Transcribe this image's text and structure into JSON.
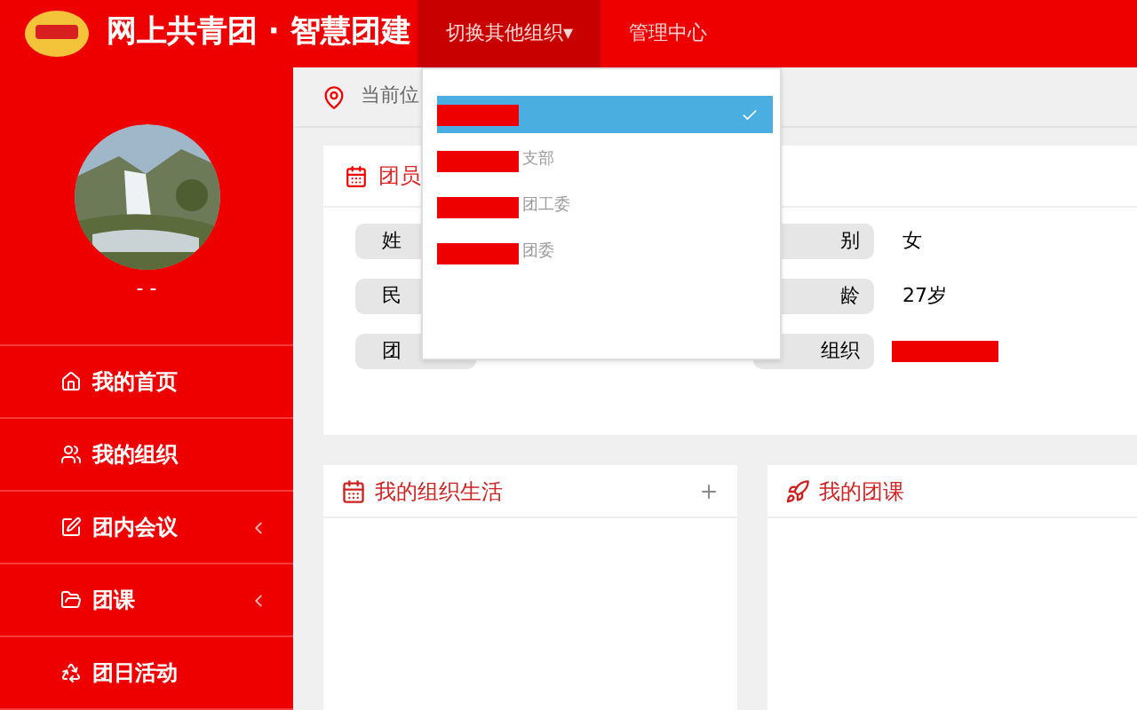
{
  "header": {
    "title": "网上共青团 · 智慧团建",
    "nav": [
      {
        "label": "切换其他组织▾",
        "selected": true
      },
      {
        "label": "管理中心",
        "selected": false
      }
    ]
  },
  "sidebar": {
    "user_name": "- -",
    "items": [
      {
        "label": "我的首页",
        "expandable": false
      },
      {
        "label": "我的组织",
        "expandable": false
      },
      {
        "label": "团内会议",
        "expandable": true
      },
      {
        "label": "团课",
        "expandable": true
      },
      {
        "label": "团日活动",
        "expandable": false
      }
    ]
  },
  "breadcrumb": {
    "label": "当前位"
  },
  "profile_card": {
    "title": "团员",
    "left_fields": [
      {
        "label": "姓"
      },
      {
        "label": "民"
      },
      {
        "label": "团"
      }
    ],
    "right_fields": [
      {
        "label": "别",
        "value": "女"
      },
      {
        "label": "龄",
        "value": "27岁"
      },
      {
        "label": "组织",
        "redacted": true
      }
    ]
  },
  "org_dropdown": {
    "items": [
      {
        "redacted": true,
        "selected": true
      },
      {
        "label": "支部",
        "redacted": true,
        "selected": false
      },
      {
        "label": "团工委",
        "redacted": true,
        "selected": false
      },
      {
        "label": "团委",
        "redacted": true,
        "selected": false
      }
    ]
  },
  "panels": [
    {
      "title": "我的组织生活",
      "add": true
    },
    {
      "title": "我的团课",
      "add": false
    }
  ]
}
